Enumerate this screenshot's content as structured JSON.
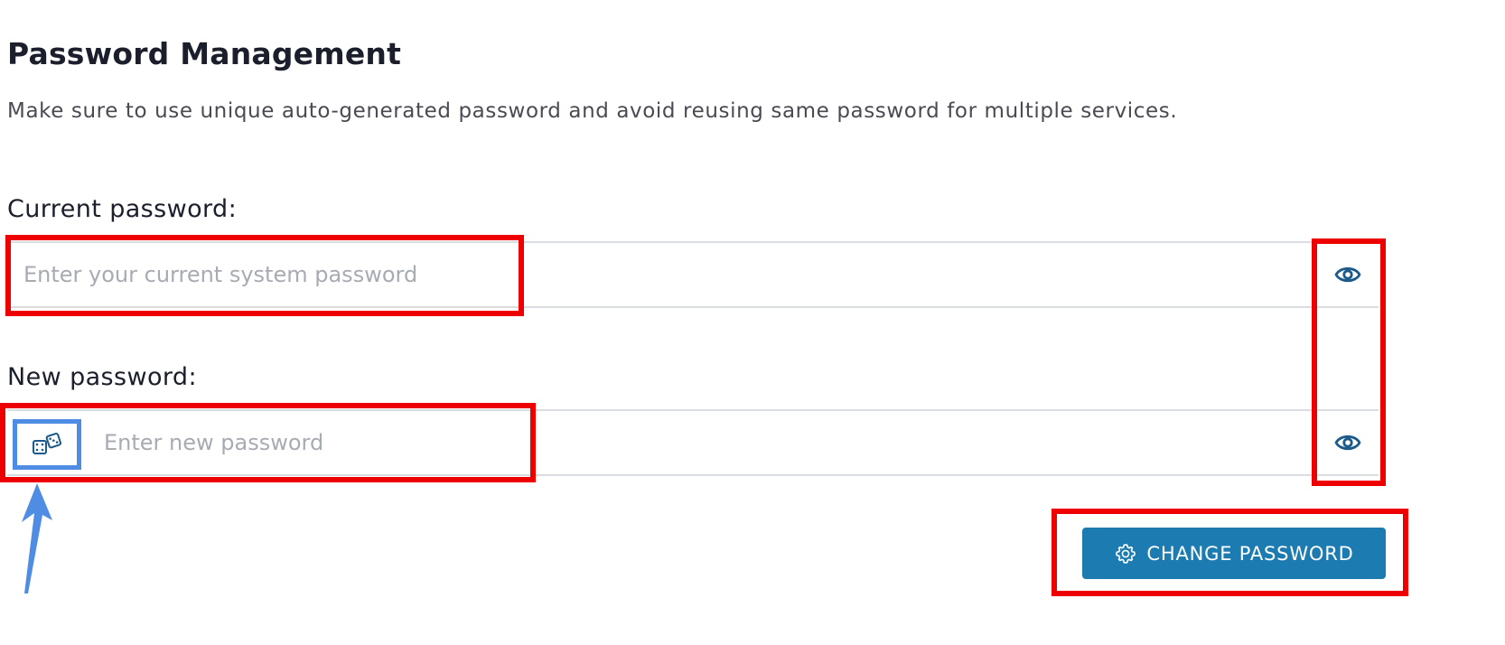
{
  "section": {
    "title": "Password Management",
    "description": "Make sure to use unique auto-generated password and avoid reusing same password for multiple services."
  },
  "current_password": {
    "label": "Current password:",
    "placeholder": "Enter your current system password",
    "toggle_icon": "eye-icon"
  },
  "new_password": {
    "label": "New password:",
    "placeholder": "Enter new password",
    "generate_icon": "dice-icon",
    "toggle_icon": "eye-icon"
  },
  "actions": {
    "change_password_label": "CHANGE PASSWORD",
    "change_password_icon": "gear-icon"
  },
  "colors": {
    "accent": "#1c7bb0",
    "annotation_red": "#ee0000",
    "annotation_blue": "#4f8ce3"
  }
}
